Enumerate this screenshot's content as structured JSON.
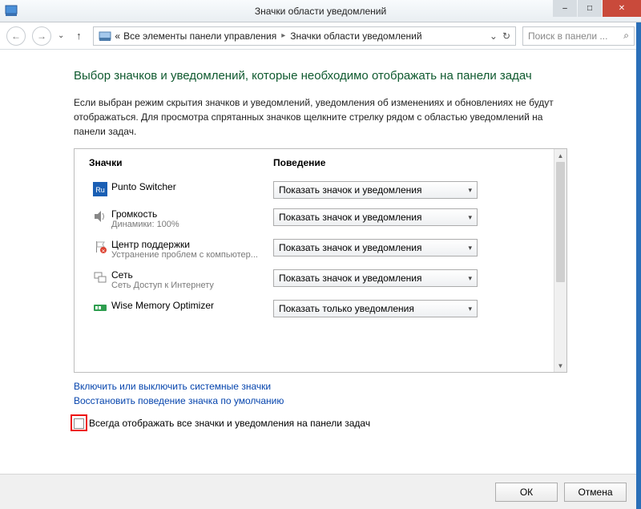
{
  "window": {
    "title": "Значки области уведомлений",
    "minimize": "–",
    "maximize": "□",
    "close": "✕"
  },
  "toolbar": {
    "back": "←",
    "forward": "→",
    "up": "↑",
    "breadcrumb_prefix": "«",
    "crumb1": "Все элементы панели управления",
    "crumb2": "Значки области уведомлений",
    "refresh": "↻",
    "dropdown": "⌄",
    "search_placeholder": "Поиск в панели ...",
    "search_icon": "⌕"
  },
  "help": "?",
  "heading": "Выбор значков и уведомлений, которые необходимо отображать на панели задач",
  "description": "Если выбран режим скрытия значков и уведомлений, уведомления об изменениях и обновлениях не будут отображаться. Для просмотра спрятанных значков щелкните стрелку рядом с областью уведомлений на панели задач.",
  "columns": {
    "c1": "Значки",
    "c2": "Поведение"
  },
  "behavior_option_show": "Показать значок и уведомления",
  "behavior_option_notify": "Показать только уведомления",
  "rows": [
    {
      "icon": "ru",
      "name": "Punto Switcher",
      "sub": "",
      "behavior": "Показать значок и уведомления"
    },
    {
      "icon": "vol",
      "name": "Громкость",
      "sub": "Динамики: 100%",
      "behavior": "Показать значок и уведомления"
    },
    {
      "icon": "flag",
      "name": "Центр поддержки",
      "sub": "Устранение проблем с компьютер...",
      "behavior": "Показать значок и уведомления"
    },
    {
      "icon": "net",
      "name": "Сеть",
      "sub": "Сеть Доступ к Интернету",
      "behavior": "Показать значок и уведомления"
    },
    {
      "icon": "wise",
      "name": "Wise Memory Optimizer",
      "sub": "",
      "behavior": "Показать только уведомления"
    }
  ],
  "link1": "Включить или выключить системные значки",
  "link2": "Восстановить поведение значка по умолчанию",
  "checkbox_label": "Всегда отображать все значки и уведомления на панели задач",
  "buttons": {
    "ok": "ОК",
    "cancel": "Отмена"
  }
}
